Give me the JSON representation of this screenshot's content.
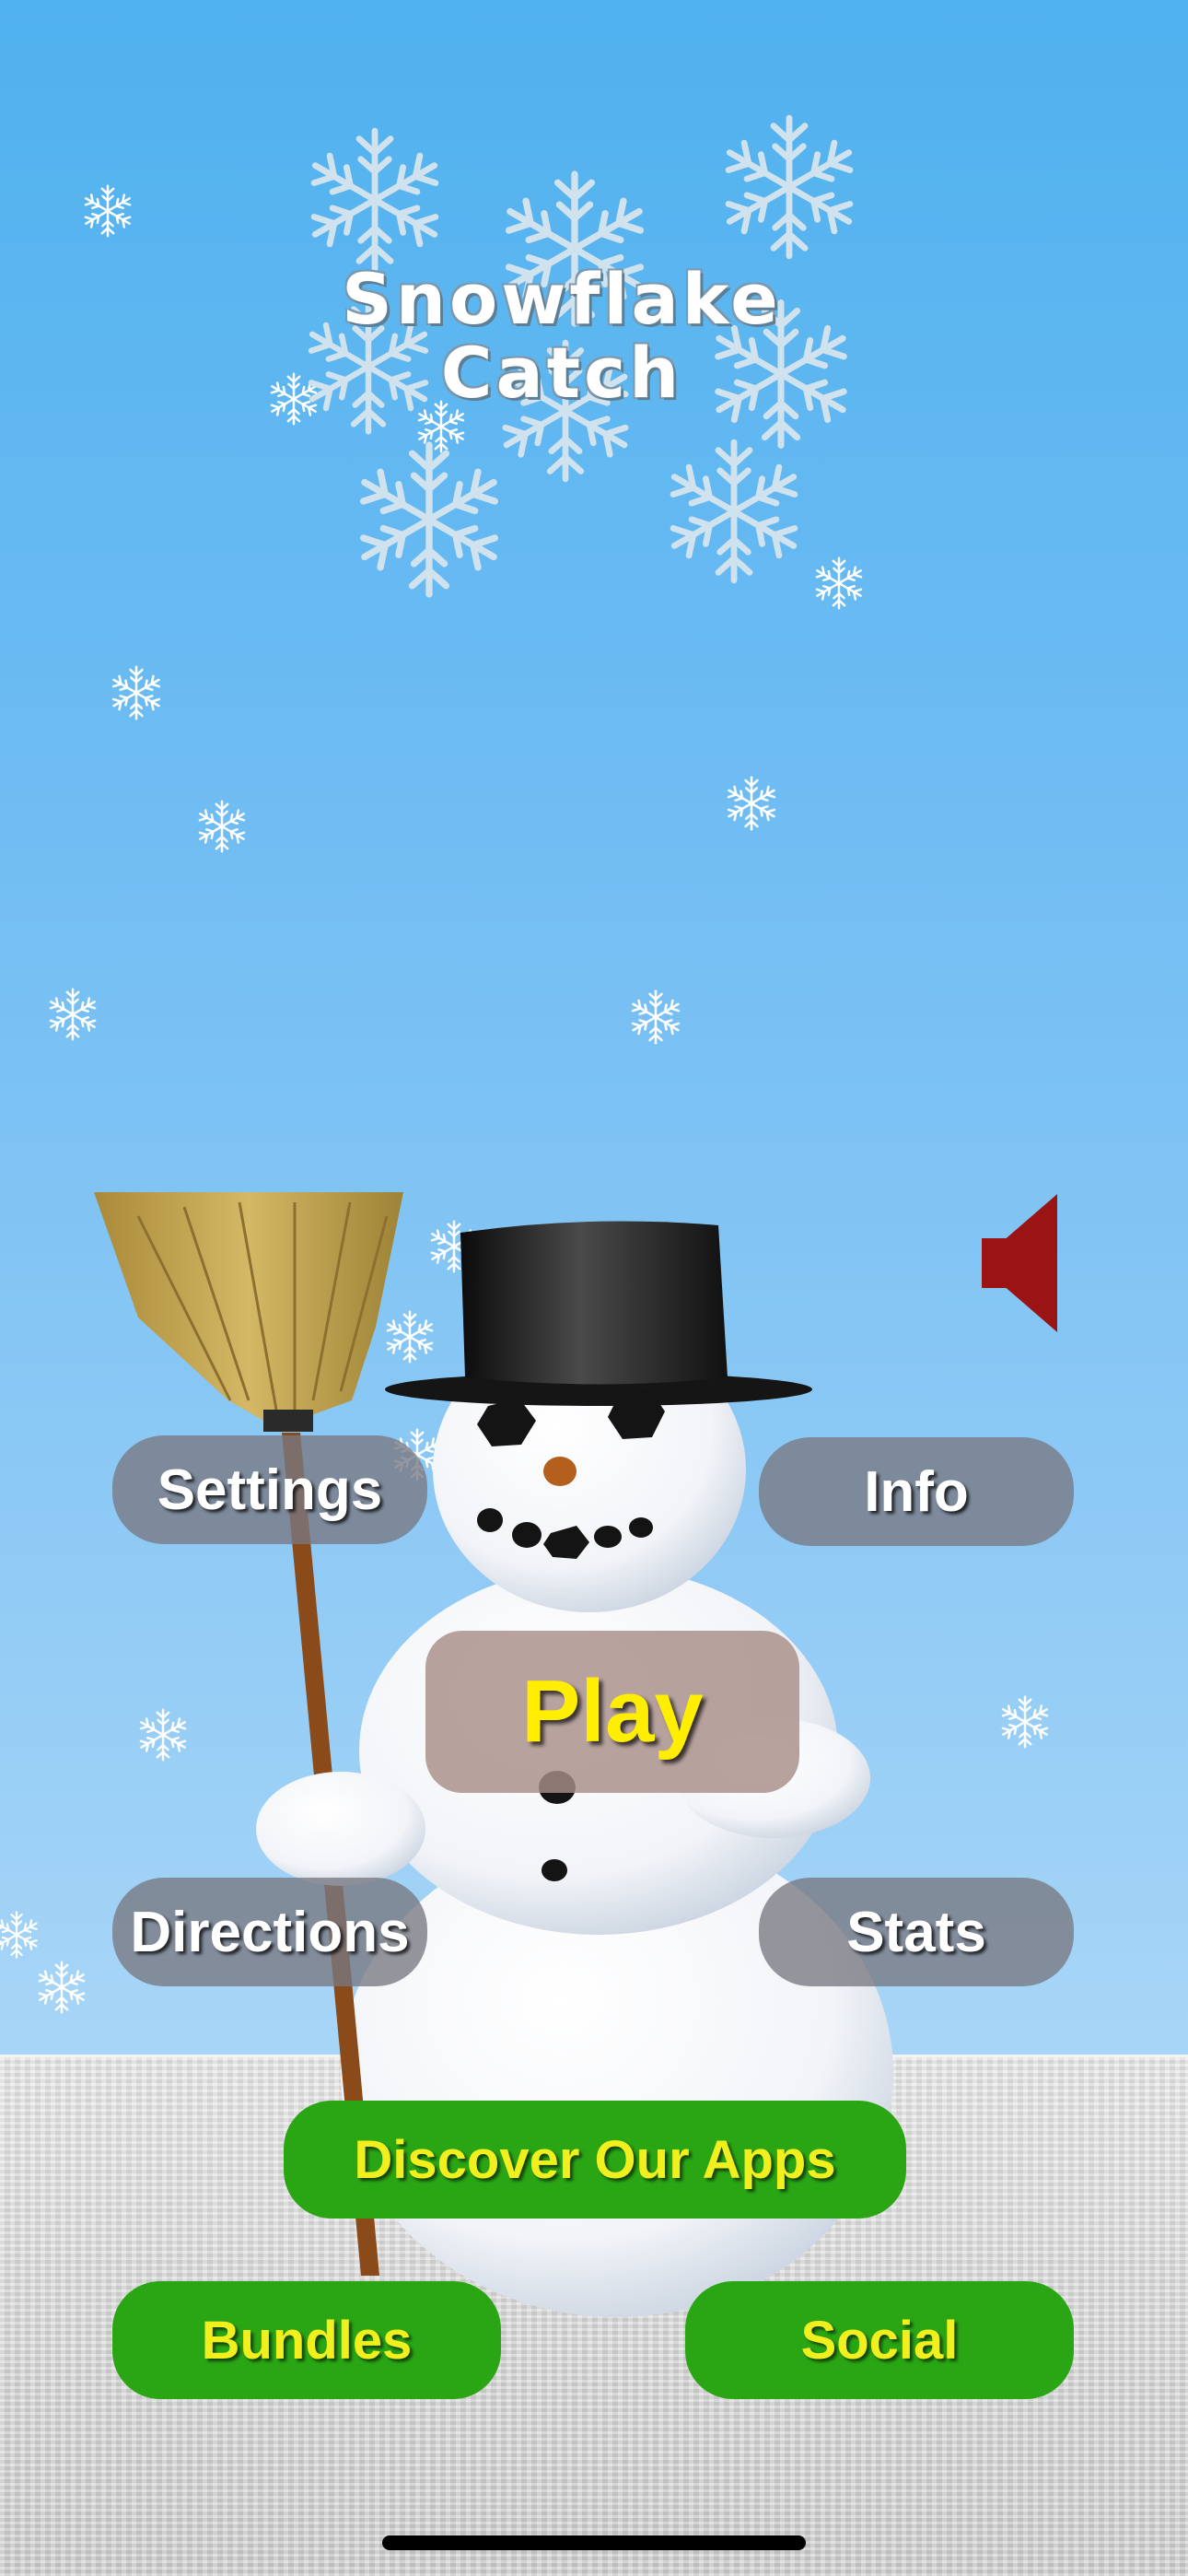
{
  "game": {
    "title_line1": "Snowflake",
    "title_line2": "Catch"
  },
  "buttons": {
    "settings": "Settings",
    "info": "Info",
    "play": "Play",
    "directions": "Directions",
    "stats": "Stats",
    "discover": "Discover Our Apps",
    "bundles": "Bundles",
    "social": "Social"
  },
  "icons": {
    "sound": "speaker-icon",
    "snowflake": "snowflake-icon"
  },
  "colors": {
    "sky_top": "#4fb1ee",
    "sky_bottom": "#a7d5f7",
    "play_text": "#ffee00",
    "green_button": "#2aa615",
    "green_button_text": "#f2ef1f",
    "speaker": "#9a1414"
  }
}
